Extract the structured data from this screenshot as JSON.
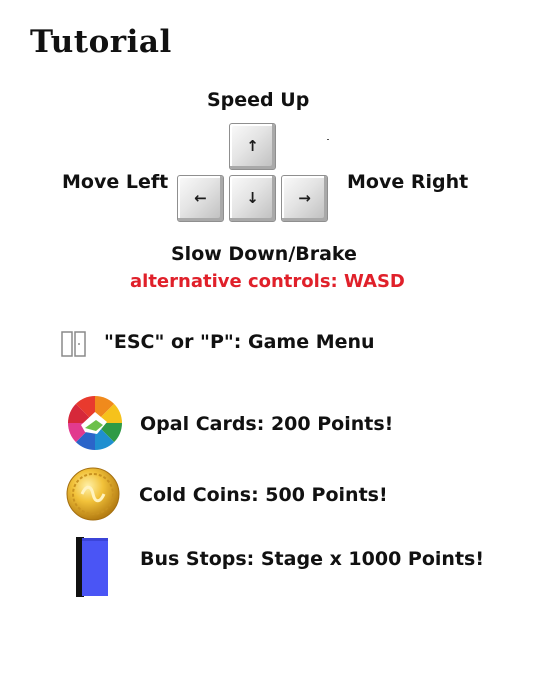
{
  "title": "Tutorial",
  "controls": {
    "up_label": "Speed Up",
    "left_label": "Move Left",
    "right_label": "Move Right",
    "down_label": "Slow Down/Brake",
    "alternative": "alternative controls: WASD",
    "alternative_color": "#e0202a",
    "keys": {
      "up": "↑",
      "left": "←",
      "down": "↓",
      "right": "→"
    }
  },
  "menu": {
    "text": "\"ESC\"  or \"P\":   Game Menu",
    "icon": "pause-icon"
  },
  "items": [
    {
      "icon": "opal-card-icon",
      "text": "Opal Cards: 200 Points!"
    },
    {
      "icon": "gold-coin-icon",
      "text": "Cold Coins: 500 Points!"
    },
    {
      "icon": "bus-stop-icon",
      "text": "Bus Stops: Stage x 1000 Points!"
    }
  ],
  "colors": {
    "bus_stop": "#4a55f5",
    "coin": "#e8b32a"
  }
}
